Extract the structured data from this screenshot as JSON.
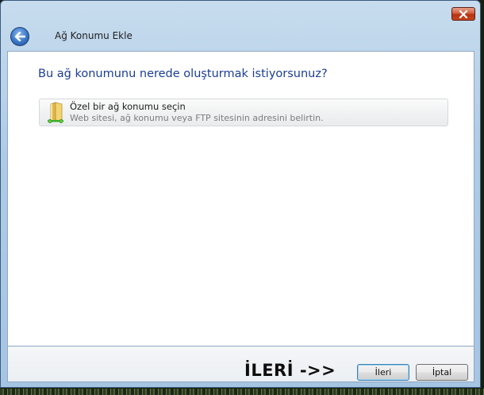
{
  "window": {
    "title": "Ağ Konumu Ekle",
    "icons": {
      "close": "close-icon",
      "back": "back-arrow-icon"
    }
  },
  "main": {
    "question": "Bu ağ konumunu nerede oluşturmak istiyorsunuz?",
    "option": {
      "label": "Özel bir ağ konumu seçin",
      "description": "Web sitesi, ağ konumu veya FTP sitesinin adresini belirtin.",
      "icon": "network-folder-icon"
    }
  },
  "footer": {
    "annotation": "İLERİ ->>",
    "next_label": "İleri",
    "cancel_label": "İptal"
  },
  "colors": {
    "heading": "#1b3d93",
    "close_button": "#c8441e",
    "chrome": "#a6c5e3"
  }
}
